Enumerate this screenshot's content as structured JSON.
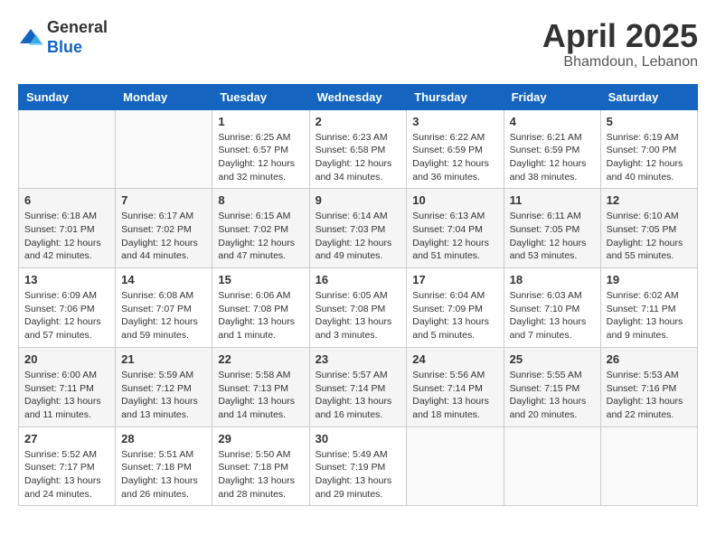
{
  "header": {
    "logo_general": "General",
    "logo_blue": "Blue",
    "month_title": "April 2025",
    "location": "Bhamdoun, Lebanon"
  },
  "weekdays": [
    "Sunday",
    "Monday",
    "Tuesday",
    "Wednesday",
    "Thursday",
    "Friday",
    "Saturday"
  ],
  "weeks": [
    [
      {
        "day": "",
        "info": ""
      },
      {
        "day": "",
        "info": ""
      },
      {
        "day": "1",
        "info": "Sunrise: 6:25 AM\nSunset: 6:57 PM\nDaylight: 12 hours\nand 32 minutes."
      },
      {
        "day": "2",
        "info": "Sunrise: 6:23 AM\nSunset: 6:58 PM\nDaylight: 12 hours\nand 34 minutes."
      },
      {
        "day": "3",
        "info": "Sunrise: 6:22 AM\nSunset: 6:59 PM\nDaylight: 12 hours\nand 36 minutes."
      },
      {
        "day": "4",
        "info": "Sunrise: 6:21 AM\nSunset: 6:59 PM\nDaylight: 12 hours\nand 38 minutes."
      },
      {
        "day": "5",
        "info": "Sunrise: 6:19 AM\nSunset: 7:00 PM\nDaylight: 12 hours\nand 40 minutes."
      }
    ],
    [
      {
        "day": "6",
        "info": "Sunrise: 6:18 AM\nSunset: 7:01 PM\nDaylight: 12 hours\nand 42 minutes."
      },
      {
        "day": "7",
        "info": "Sunrise: 6:17 AM\nSunset: 7:02 PM\nDaylight: 12 hours\nand 44 minutes."
      },
      {
        "day": "8",
        "info": "Sunrise: 6:15 AM\nSunset: 7:02 PM\nDaylight: 12 hours\nand 47 minutes."
      },
      {
        "day": "9",
        "info": "Sunrise: 6:14 AM\nSunset: 7:03 PM\nDaylight: 12 hours\nand 49 minutes."
      },
      {
        "day": "10",
        "info": "Sunrise: 6:13 AM\nSunset: 7:04 PM\nDaylight: 12 hours\nand 51 minutes."
      },
      {
        "day": "11",
        "info": "Sunrise: 6:11 AM\nSunset: 7:05 PM\nDaylight: 12 hours\nand 53 minutes."
      },
      {
        "day": "12",
        "info": "Sunrise: 6:10 AM\nSunset: 7:05 PM\nDaylight: 12 hours\nand 55 minutes."
      }
    ],
    [
      {
        "day": "13",
        "info": "Sunrise: 6:09 AM\nSunset: 7:06 PM\nDaylight: 12 hours\nand 57 minutes."
      },
      {
        "day": "14",
        "info": "Sunrise: 6:08 AM\nSunset: 7:07 PM\nDaylight: 12 hours\nand 59 minutes."
      },
      {
        "day": "15",
        "info": "Sunrise: 6:06 AM\nSunset: 7:08 PM\nDaylight: 13 hours\nand 1 minute."
      },
      {
        "day": "16",
        "info": "Sunrise: 6:05 AM\nSunset: 7:08 PM\nDaylight: 13 hours\nand 3 minutes."
      },
      {
        "day": "17",
        "info": "Sunrise: 6:04 AM\nSunset: 7:09 PM\nDaylight: 13 hours\nand 5 minutes."
      },
      {
        "day": "18",
        "info": "Sunrise: 6:03 AM\nSunset: 7:10 PM\nDaylight: 13 hours\nand 7 minutes."
      },
      {
        "day": "19",
        "info": "Sunrise: 6:02 AM\nSunset: 7:11 PM\nDaylight: 13 hours\nand 9 minutes."
      }
    ],
    [
      {
        "day": "20",
        "info": "Sunrise: 6:00 AM\nSunset: 7:11 PM\nDaylight: 13 hours\nand 11 minutes."
      },
      {
        "day": "21",
        "info": "Sunrise: 5:59 AM\nSunset: 7:12 PM\nDaylight: 13 hours\nand 13 minutes."
      },
      {
        "day": "22",
        "info": "Sunrise: 5:58 AM\nSunset: 7:13 PM\nDaylight: 13 hours\nand 14 minutes."
      },
      {
        "day": "23",
        "info": "Sunrise: 5:57 AM\nSunset: 7:14 PM\nDaylight: 13 hours\nand 16 minutes."
      },
      {
        "day": "24",
        "info": "Sunrise: 5:56 AM\nSunset: 7:14 PM\nDaylight: 13 hours\nand 18 minutes."
      },
      {
        "day": "25",
        "info": "Sunrise: 5:55 AM\nSunset: 7:15 PM\nDaylight: 13 hours\nand 20 minutes."
      },
      {
        "day": "26",
        "info": "Sunrise: 5:53 AM\nSunset: 7:16 PM\nDaylight: 13 hours\nand 22 minutes."
      }
    ],
    [
      {
        "day": "27",
        "info": "Sunrise: 5:52 AM\nSunset: 7:17 PM\nDaylight: 13 hours\nand 24 minutes."
      },
      {
        "day": "28",
        "info": "Sunrise: 5:51 AM\nSunset: 7:18 PM\nDaylight: 13 hours\nand 26 minutes."
      },
      {
        "day": "29",
        "info": "Sunrise: 5:50 AM\nSunset: 7:18 PM\nDaylight: 13 hours\nand 28 minutes."
      },
      {
        "day": "30",
        "info": "Sunrise: 5:49 AM\nSunset: 7:19 PM\nDaylight: 13 hours\nand 29 minutes."
      },
      {
        "day": "",
        "info": ""
      },
      {
        "day": "",
        "info": ""
      },
      {
        "day": "",
        "info": ""
      }
    ]
  ]
}
